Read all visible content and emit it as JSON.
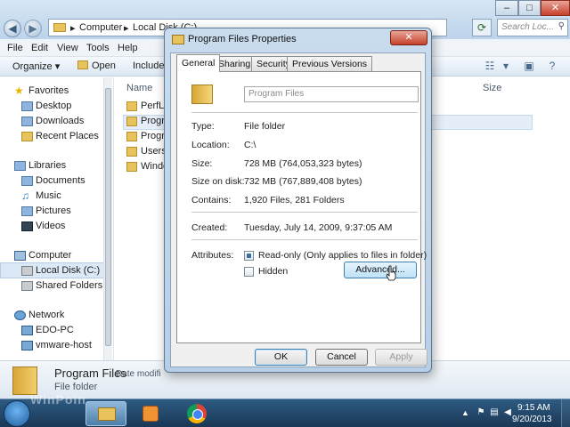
{
  "explorer": {
    "address": {
      "crumb1": "Computer",
      "crumb2": "Local Disk (C:)",
      "sep": "▸"
    },
    "search_placeholder": "Search Loc...",
    "menu": [
      "File",
      "Edit",
      "View",
      "Tools",
      "Help"
    ],
    "toolbar": {
      "organize": "Organize ▾",
      "open": "Open",
      "include": "Include"
    },
    "nav": {
      "favorites": "Favorites",
      "desktop": "Desktop",
      "downloads": "Downloads",
      "recent": "Recent Places",
      "libraries": "Libraries",
      "documents": "Documents",
      "music": "Music",
      "pictures": "Pictures",
      "videos": "Videos",
      "computer": "Computer",
      "local_disk": "Local Disk (C:)",
      "shared": "Shared Folders (\\",
      "network": "Network",
      "edo_pc": "EDO-PC",
      "vmware": "vmware-host"
    },
    "columns": {
      "name": "Name",
      "size": "Size"
    },
    "rows": [
      "PerfLo",
      "Progra",
      "Progra",
      "Users",
      "Windo"
    ],
    "details": {
      "name": "Program Files",
      "type": "File folder",
      "modified": "Date modifi"
    }
  },
  "dialog": {
    "title": "Program Files Properties",
    "close": "✕",
    "tabs": {
      "general": "General",
      "sharing": "Sharing",
      "security": "Security",
      "previous": "Previous Versions"
    },
    "name_value": "Program Files",
    "labels": {
      "type": "Type:",
      "location": "Location:",
      "size": "Size:",
      "size_on_disk": "Size on disk:",
      "contains": "Contains:",
      "created": "Created:",
      "attributes": "Attributes:"
    },
    "values": {
      "type": "File folder",
      "location": "C:\\",
      "size": "728 MB (764,053,323 bytes)",
      "size_on_disk": "732 MB (767,889,408 bytes)",
      "contains": "1,920 Files, 281 Folders",
      "created": "Tuesday, July 14, 2009, 9:37:05 AM"
    },
    "attributes": {
      "readonly": "Read-only (Only applies to files in folder)",
      "hidden": "Hidden"
    },
    "buttons": {
      "advanced": "Advanced...",
      "ok": "OK",
      "cancel": "Cancel",
      "apply": "Apply"
    }
  },
  "taskbar": {
    "time": "9:15 AM",
    "date": "9/20/2013"
  },
  "watermark": "WinPoin",
  "colors": {
    "accent": "#3c7fb1",
    "taskbar": "#1f4466",
    "selection": "#dbe8f5"
  }
}
